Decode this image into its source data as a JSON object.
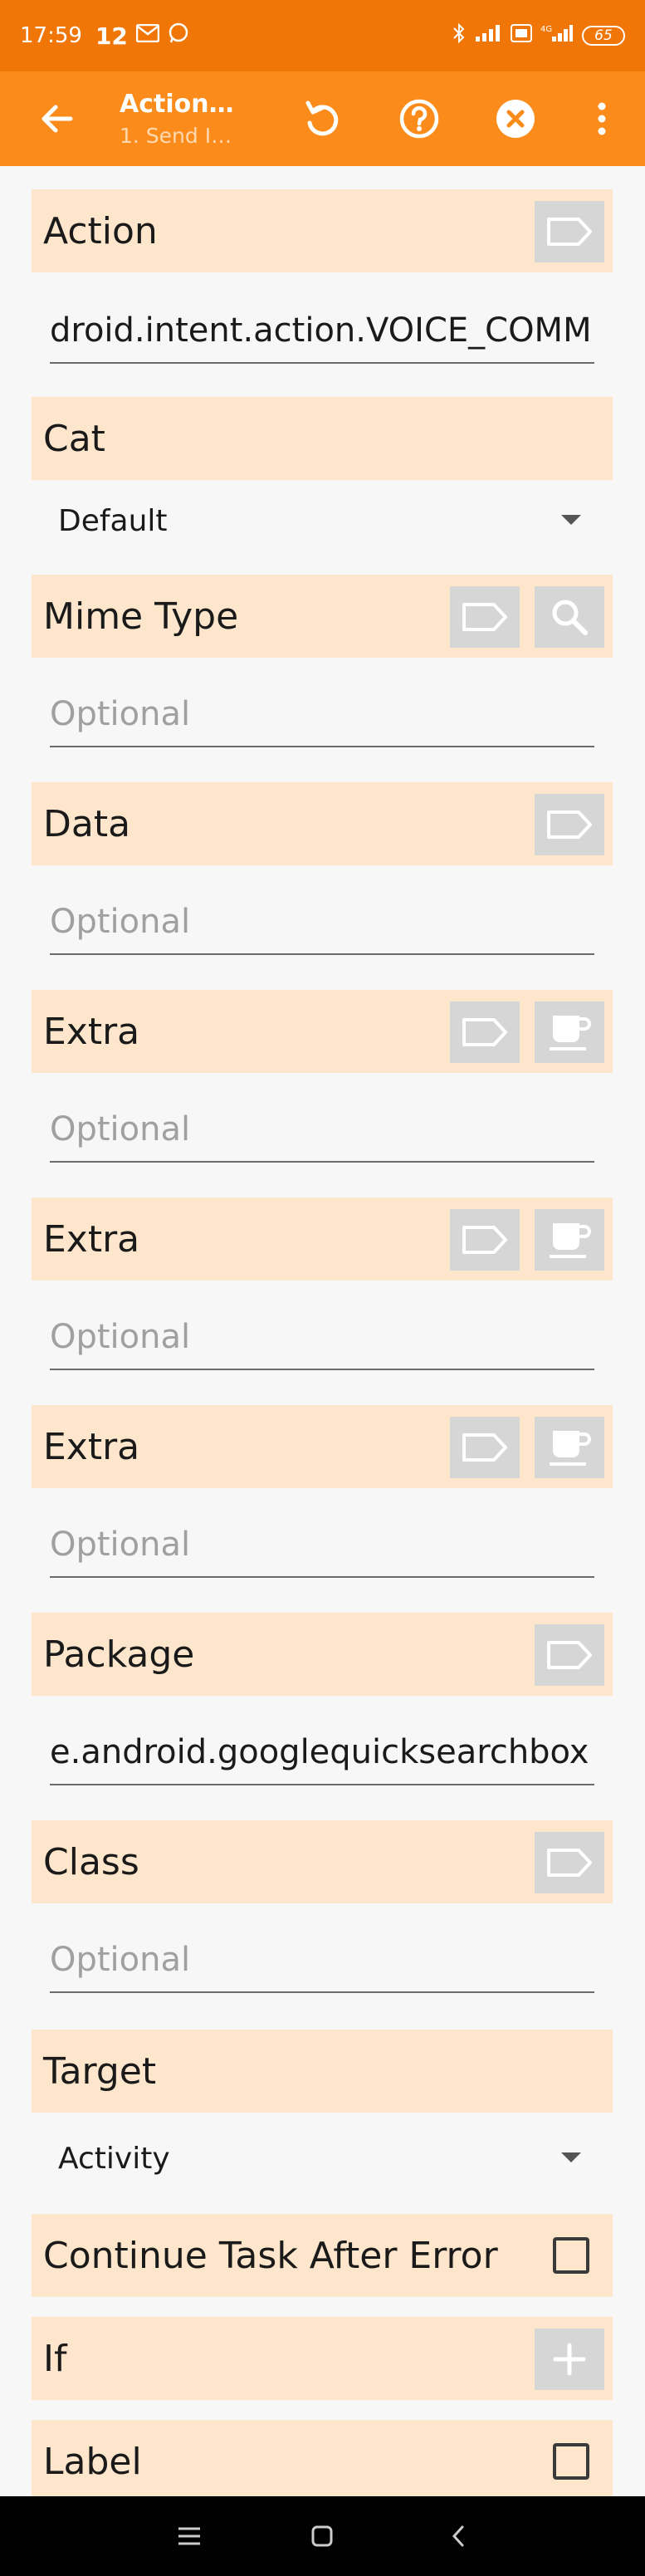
{
  "status_bar": {
    "time": "17:59",
    "notif_count": "12",
    "battery": "65"
  },
  "app_bar": {
    "title": "Action…",
    "subtitle": "1. Send I…"
  },
  "sections": {
    "action": {
      "label": "Action",
      "value": "droid.intent.action.VOICE_COMM"
    },
    "cat": {
      "label": "Cat",
      "selected": "Default"
    },
    "mime_type": {
      "label": "Mime Type",
      "placeholder": "Optional"
    },
    "data": {
      "label": "Data",
      "placeholder": "Optional"
    },
    "extra1": {
      "label": "Extra",
      "placeholder": "Optional"
    },
    "extra2": {
      "label": "Extra",
      "placeholder": "Optional"
    },
    "extra3": {
      "label": "Extra",
      "placeholder": "Optional"
    },
    "package": {
      "label": "Package",
      "value": "e.android.googlequicksearchbox"
    },
    "class": {
      "label": "Class",
      "placeholder": "Optional"
    },
    "target": {
      "label": "Target",
      "selected": "Activity"
    },
    "continue_after_error": {
      "label": "Continue Task After Error",
      "checked": false
    },
    "if": {
      "label": "If"
    },
    "label": {
      "label": "Label",
      "checked": false
    }
  },
  "colors": {
    "status_bar": "#f07607",
    "app_bar": "#fb8c1c",
    "section_bg": "#fde6cc",
    "icon_button_bg": "#d6d6d6"
  }
}
